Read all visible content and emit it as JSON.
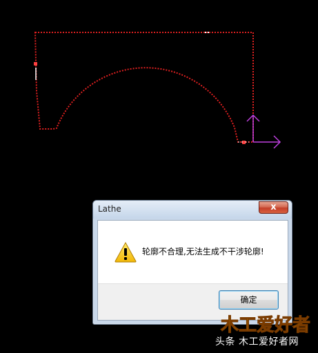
{
  "dialog": {
    "title": "Lathe",
    "close_label": "x",
    "message": "轮廓不合理,无法生成不干涉轮廓!",
    "ok_label": "确定",
    "icon": "warning-icon"
  },
  "canvas": {
    "profile_color": "#e02020",
    "axis_color": "#c040e0",
    "background": "#000000"
  },
  "watermark": {
    "logo_text": "木工爱好者",
    "caption": "头条  木工爱好者网"
  }
}
